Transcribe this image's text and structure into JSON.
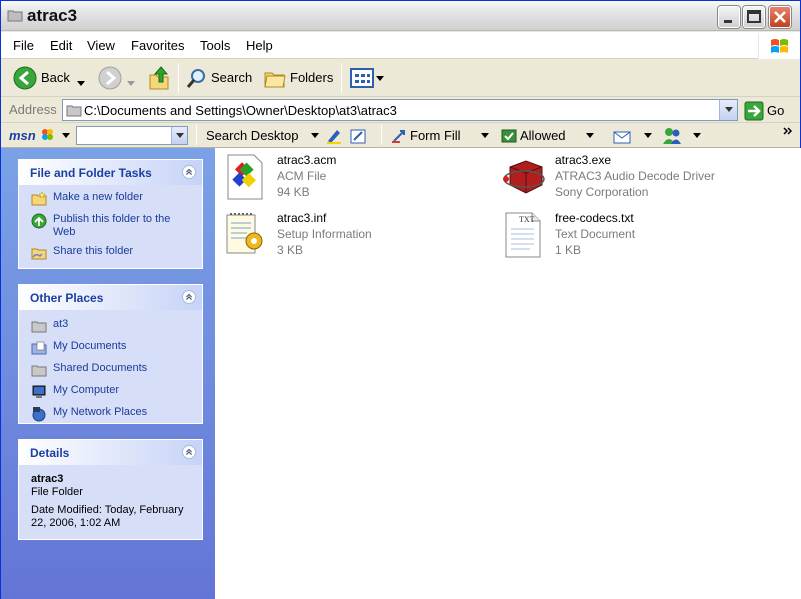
{
  "window": {
    "title": "atrac3"
  },
  "menu": [
    "File",
    "Edit",
    "View",
    "Favorites",
    "Tools",
    "Help"
  ],
  "toolbar": {
    "back": "Back",
    "search": "Search",
    "folders": "Folders"
  },
  "address": {
    "label": "Address",
    "value": "C:\\Documents and Settings\\Owner\\Desktop\\at3\\atrac3",
    "go": "Go"
  },
  "msn": {
    "search_desktop": "Search Desktop",
    "form_fill": "Form Fill",
    "allowed": "Allowed"
  },
  "panels": {
    "tasks": {
      "title": "File and Folder Tasks",
      "items": [
        "Make a new folder",
        "Publish this folder to the Web",
        "Share this folder"
      ]
    },
    "places": {
      "title": "Other Places",
      "items": [
        "at3",
        "My Documents",
        "Shared Documents",
        "My Computer",
        "My Network Places"
      ]
    },
    "details": {
      "title": "Details",
      "name": "atrac3",
      "kind": "File Folder",
      "modified": "Date Modified: Today, February 22, 2006, 1:02 AM"
    }
  },
  "files": [
    {
      "name": "atrac3.acm",
      "type": "ACM File",
      "size": "94 KB",
      "icon": "acm-file-icon"
    },
    {
      "name": "atrac3.exe",
      "type": "ATRAC3 Audio Decode Driver",
      "size": "Sony Corporation",
      "icon": "exe-box-icon"
    },
    {
      "name": "atrac3.inf",
      "type": "Setup Information",
      "size": "3 KB",
      "icon": "setup-info-icon"
    },
    {
      "name": "free-codecs.txt",
      "type": "Text Document",
      "size": "1 KB",
      "icon": "text-document-icon"
    }
  ],
  "colors": {
    "title_active": "#e6e6e6",
    "sidebar_top": "#7ba2e7",
    "sidebar_bottom": "#6375d6",
    "link": "#1a3b9a"
  }
}
